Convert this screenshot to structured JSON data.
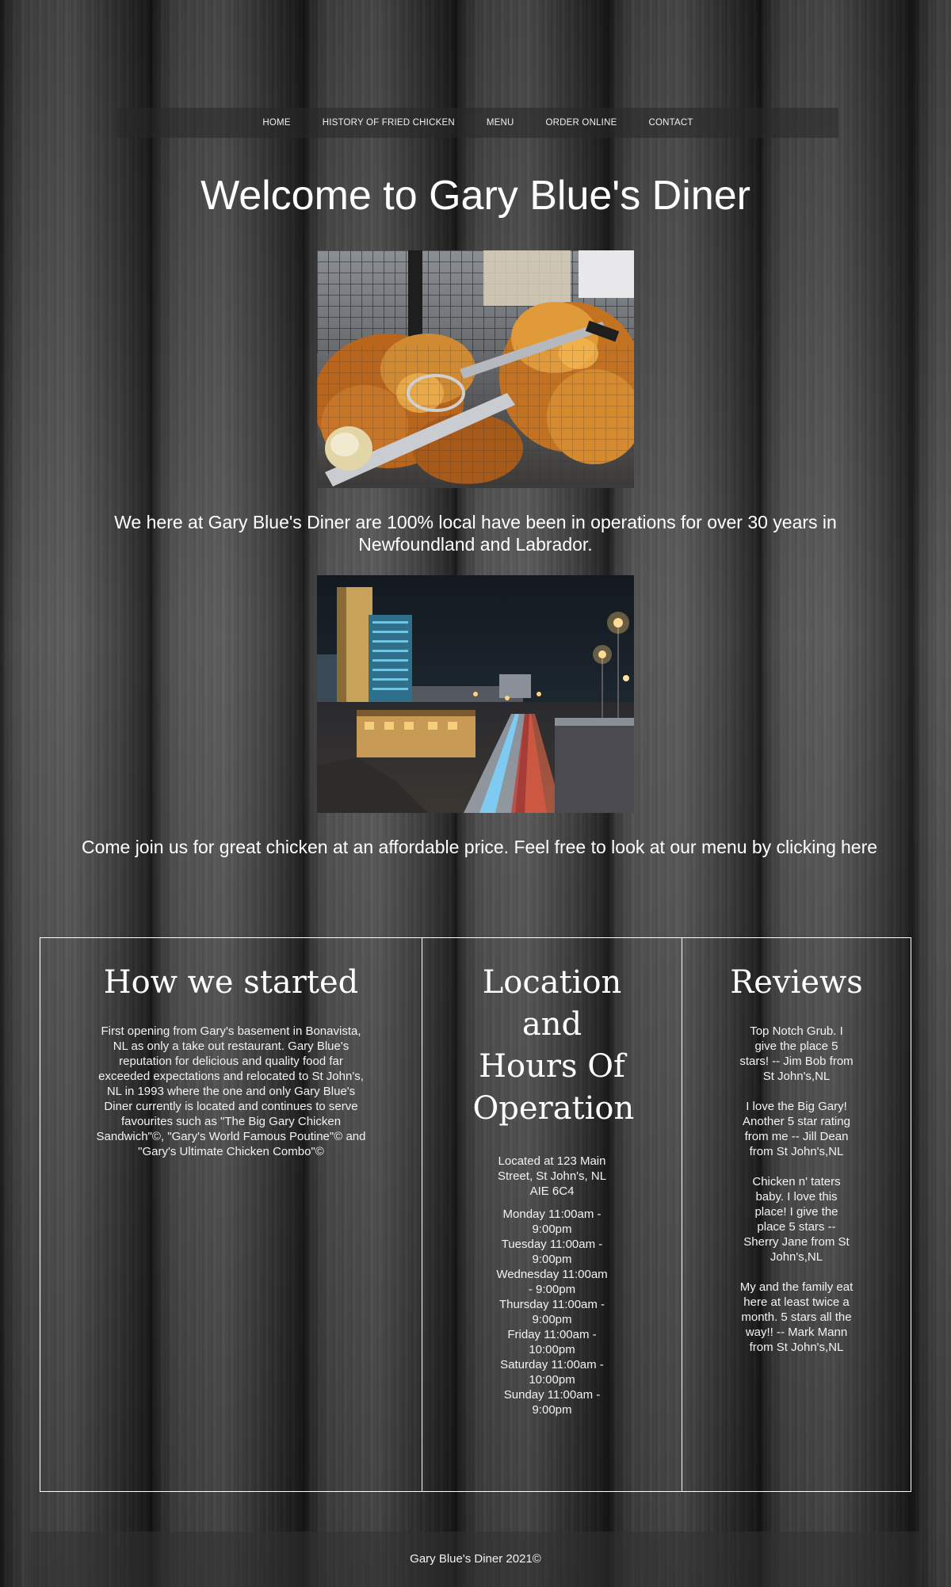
{
  "nav": {
    "items": [
      {
        "label": "HOME"
      },
      {
        "label": "HISTORY OF FRIED CHICKEN"
      },
      {
        "label": "MENU"
      },
      {
        "label": "ORDER ONLINE"
      },
      {
        "label": "CONTACT"
      }
    ]
  },
  "hero": {
    "title": "Welcome to Gary Blue's Diner"
  },
  "intro": {
    "text": "We here at Gary Blue's Diner are 100% local have been in operations for over 30 years in Newfoundland and Labrador."
  },
  "cta": {
    "text": "Come join us for great chicken at an affordable price. Feel free to look at our menu by clicking",
    "link_label": "here"
  },
  "panels": {
    "history": {
      "heading": "How we started",
      "body": "First opening from Gary's basement in Bonavista, NL as only a take out restaurant. Gary Blue's reputation for delicious and quality food far exceeded expectations and relocated to St John's, NL in 1993 where the one and only Gary Blue's Diner currently is located and continues to serve favourites such as \"The Big Gary Chicken Sandwich\"©, \"Gary's World Famous Poutine\"© and \"Gary's Ultimate Chicken Combo\"©"
    },
    "location": {
      "heading": "Location and Hours Of Operation",
      "address": "Located at 123 Main Street, St John's, NL AIE 6C4",
      "hours": [
        "Monday 11:00am - 9:00pm",
        "Tuesday 11:00am - 9:00pm",
        "Wednesday 11:00am - 9:00pm",
        "Thursday 11:00am - 9:00pm",
        "Friday 11:00am - 10:00pm",
        "Saturday 11:00am - 10:00pm",
        "Sunday 11:00am - 9:00pm"
      ]
    },
    "reviews": {
      "heading": "Reviews",
      "items": [
        "Top Notch Grub. I give the place 5 stars! -- Jim Bob from St John's,NL",
        "I love the Big Gary! Another 5 star rating from me -- Jill Dean from St John's,NL",
        "Chicken n' taters baby. I love this place! I give the place 5 stars -- Sherry Jane from St John's,NL",
        "My and the family eat here at least twice a month. 5 stars all the way!! -- Mark Mann from St John's,NL"
      ]
    }
  },
  "footer": {
    "text": "Gary Blue's Diner 2021©"
  }
}
